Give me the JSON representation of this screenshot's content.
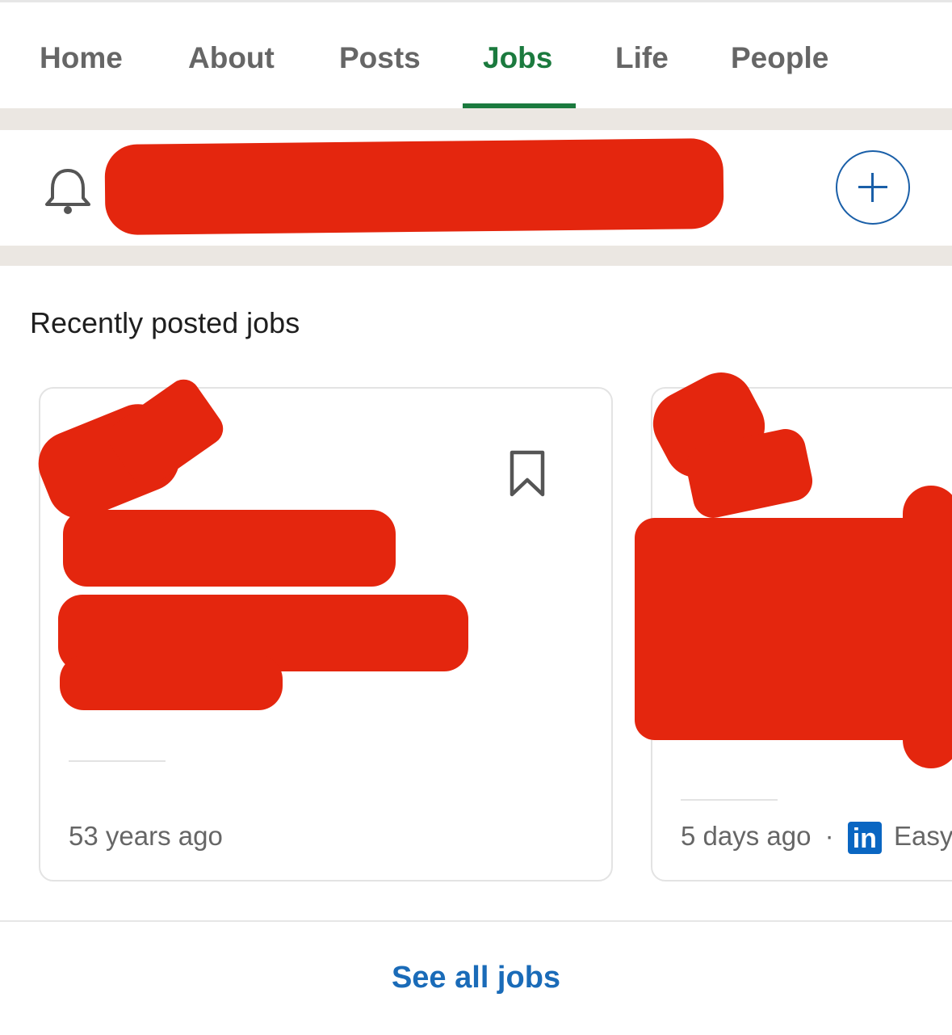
{
  "tabs": [
    {
      "label": "Home",
      "active": false
    },
    {
      "label": "About",
      "active": false
    },
    {
      "label": "Posts",
      "active": false
    },
    {
      "label": "Jobs",
      "active": true
    },
    {
      "label": "Life",
      "active": false
    },
    {
      "label": "People",
      "active": false
    }
  ],
  "colors": {
    "active_tab": "#1b7a3e",
    "link": "#1a6bb8",
    "redaction": "#e4260e",
    "linkedin_blue": "#0a66c2"
  },
  "alert": {
    "icon": "bell-icon",
    "add_icon": "plus-icon"
  },
  "jobs_section": {
    "title": "Recently posted jobs",
    "cards": [
      {
        "posted": "53 years ago",
        "icon": "bookmark-icon"
      },
      {
        "posted": "5 days ago",
        "separator": "·",
        "apply_label": "Easy",
        "logo_text": "in"
      }
    ],
    "see_all_label": "See all jobs"
  }
}
